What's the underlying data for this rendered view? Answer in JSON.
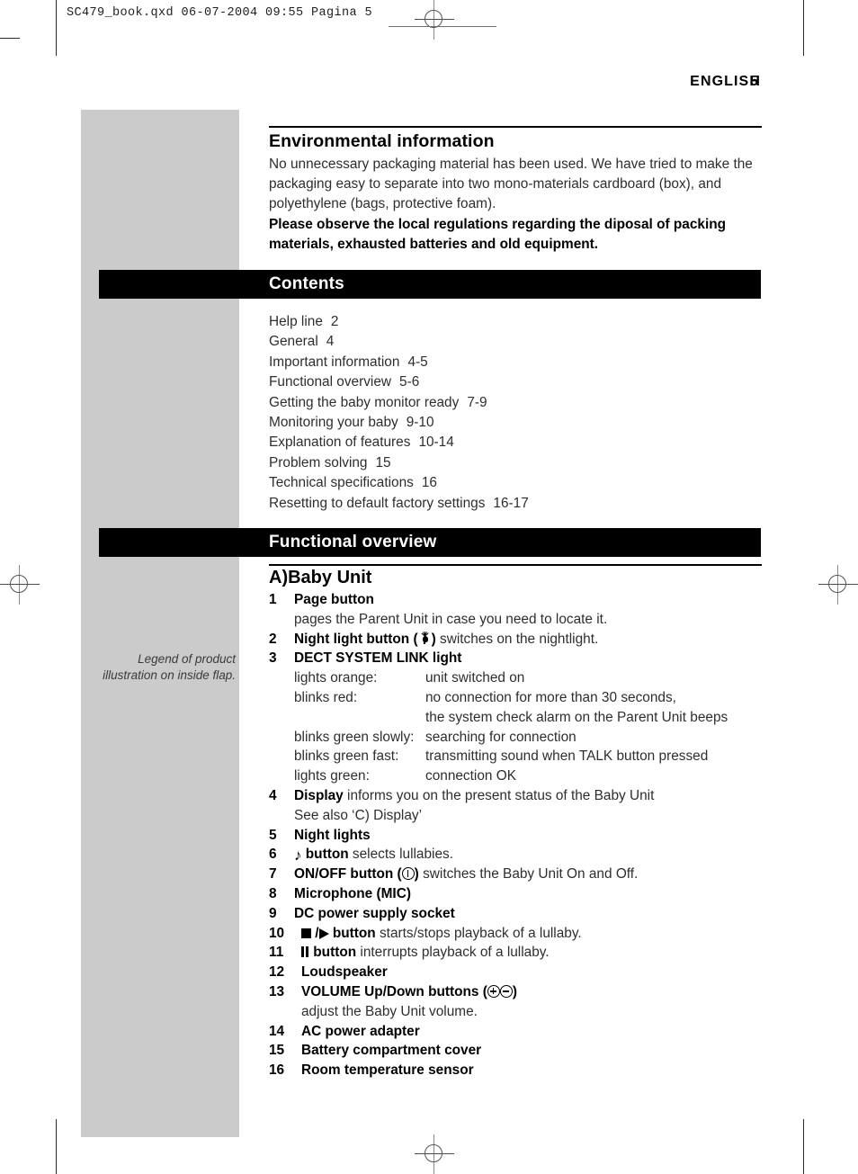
{
  "print": {
    "slug": "SC479_book.qxd  06-07-2004  09:55  Pagina 5"
  },
  "header": {
    "running_head": "ENGLISH",
    "page_number": "5"
  },
  "sidebar": {
    "legend_line1": "Legend of product",
    "legend_line2": "illustration on inside flap."
  },
  "environmental": {
    "heading": "Environmental information",
    "paragraph": "No unnecessary packaging material has been used. We have tried to make the packaging easy to separate into two mono-materials cardboard (box), and polyethylene (bags, protective foam).",
    "bold_note": "Please observe the local regulations regarding the diposal of packing materials, exhausted batteries and old equipment."
  },
  "contents": {
    "band_title": "Contents",
    "entries": [
      {
        "title": "Help line",
        "pages": "2"
      },
      {
        "title": "General",
        "pages": "4"
      },
      {
        "title": "Important information",
        "pages": "4-5"
      },
      {
        "title": "Functional overview",
        "pages": "5-6"
      },
      {
        "title": "Getting the baby monitor ready",
        "pages": "7-9"
      },
      {
        "title": "Monitoring your baby",
        "pages": "9-10"
      },
      {
        "title": "Explanation of features",
        "pages": "10-14"
      },
      {
        "title": "Problem solving",
        "pages": "15"
      },
      {
        "title": "Technical specifications",
        "pages": "16"
      },
      {
        "title": "Resetting to default factory settings",
        "pages": "16-17"
      }
    ]
  },
  "functional_overview": {
    "band_title": "Functional overview",
    "subsection_title": "A)Baby Unit",
    "items": {
      "n1": "1",
      "n1_label": "Page button",
      "n1_desc": "pages the Parent Unit in case you need to locate it.",
      "n2": "2",
      "n2_label_pre": "Night light button (",
      "n2_label_post": ")",
      "n2_desc": " switches on the nightlight.",
      "n3": "3",
      "n3_label": "DECT SYSTEM LINK light",
      "n3_rows": [
        {
          "state": "lights orange:",
          "meaning": "unit switched on"
        },
        {
          "state": "blinks red:",
          "meaning": "no connection for more than 30 seconds,"
        },
        {
          "state": "",
          "meaning": "the system check alarm on the Parent Unit beeps"
        },
        {
          "state": "blinks green slowly:",
          "meaning": "searching for connection"
        },
        {
          "state": "blinks green fast:",
          "meaning": "transmitting sound when TALK button pressed"
        },
        {
          "state": "lights green:",
          "meaning": "connection OK"
        }
      ],
      "n4": "4",
      "n4_label": "Display",
      "n4_desc": " informs you on the present status of the Baby Unit",
      "n4_desc2": "See also ‘C) Display’",
      "n5": "5",
      "n5_label": "Night lights",
      "n6": "6",
      "n6_label": " button",
      "n6_desc": " selects lullabies.",
      "n7": "7",
      "n7_label_pre": "ON/OFF button (",
      "n7_label_post": ")",
      "n7_desc": " switches the Baby Unit On and Off.",
      "n8": "8",
      "n8_label": "Microphone (MIC)",
      "n9": "9",
      "n9_label": "DC power supply socket",
      "n10": "10",
      "n10_label_mid": " /",
      "n10_label_end": " button",
      "n10_desc": " starts/stops playback of a lullaby.",
      "n11": "11",
      "n11_label": " button",
      "n11_desc": " interrupts playback of a lullaby.",
      "n12": "12",
      "n12_label": "Loudspeaker",
      "n13": "13",
      "n13_label_pre": "VOLUME Up/Down buttons (",
      "n13_label_post": ")",
      "n13_desc": "adjust the Baby Unit volume.",
      "n14": "14",
      "n14_label": "AC power adapter",
      "n15": "15",
      "n15_label": "Battery compartment cover",
      "n16": "16",
      "n16_label": "Room temperature sensor"
    }
  }
}
